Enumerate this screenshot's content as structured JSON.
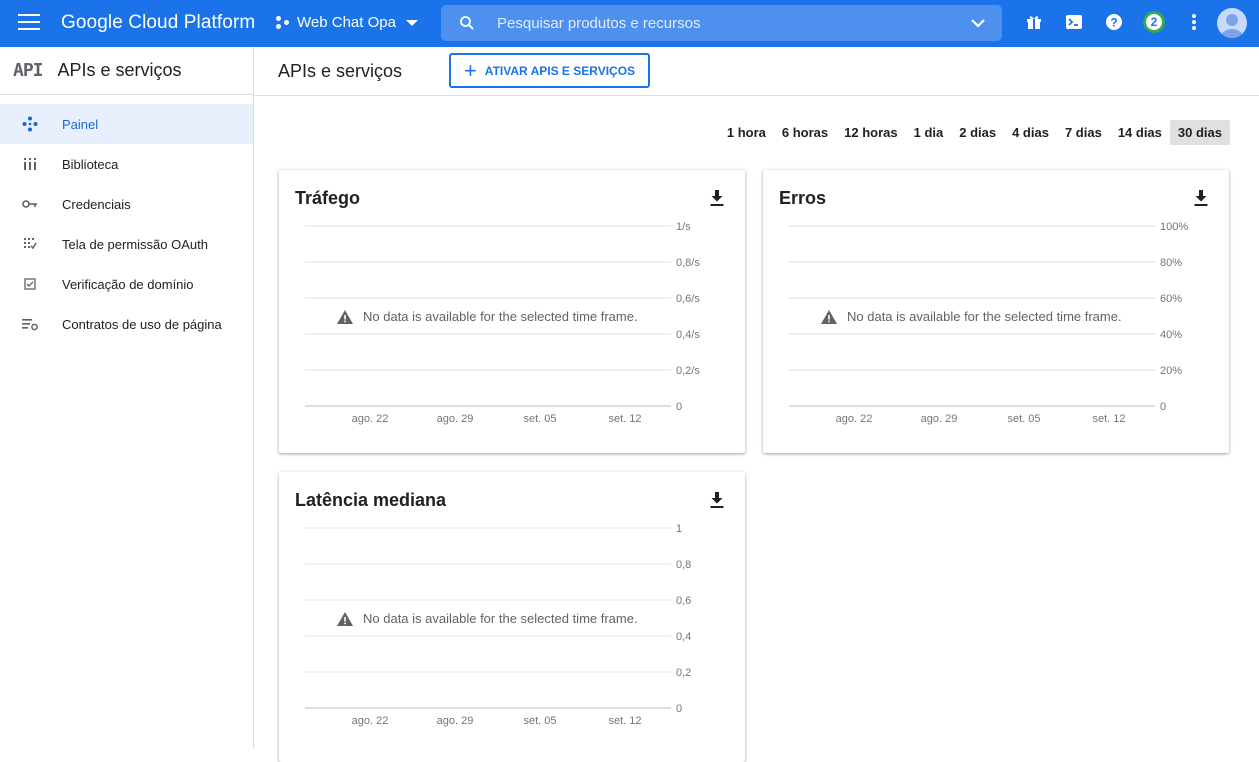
{
  "topbar": {
    "brand": "Google Cloud Platform",
    "project": "Web Chat Opa",
    "search_placeholder": "Pesquisar produtos e recursos",
    "notification_count": "2",
    "icons": [
      "gift-icon",
      "cloud-shell-icon",
      "help-icon",
      "notifications-badge",
      "more-vert-icon",
      "account-avatar"
    ]
  },
  "sidebar": {
    "logo": "API",
    "title": "APIs e serviços",
    "items": [
      {
        "label": "Painel",
        "icon": "dashboard-icon",
        "active": true
      },
      {
        "label": "Biblioteca",
        "icon": "library-icon"
      },
      {
        "label": "Credenciais",
        "icon": "key-icon"
      },
      {
        "label": "Tela de permissão OAuth",
        "icon": "oauth-consent-icon"
      },
      {
        "label": "Verificação de domínio",
        "icon": "domain-check-icon"
      },
      {
        "label": "Contratos de uso de página",
        "icon": "page-usage-icon"
      }
    ]
  },
  "main": {
    "title": "APIs e serviços",
    "enable_button": "ATIVAR APIS E SERVIÇOS",
    "time_ranges": [
      "1 hora",
      "6 horas",
      "12 horas",
      "1 dia",
      "2 dias",
      "4 dias",
      "7 dias",
      "14 dias",
      "30 dias"
    ],
    "selected_range": "30 dias",
    "no_data_message": "No data is available for the selected time frame."
  },
  "colors": {
    "accent": "#1a73e8",
    "active_bg": "#e8f0fe",
    "badge_ring": "#34a853"
  },
  "chart_data": [
    {
      "type": "line",
      "title": "Tráfego",
      "x": [
        "ago. 22",
        "ago. 29",
        "set. 05",
        "set. 12"
      ],
      "yticks": [
        "1/s",
        "0,8/s",
        "0,6/s",
        "0,4/s",
        "0,2/s",
        "0"
      ],
      "ylim": [
        0,
        1
      ],
      "series": [],
      "grid": true
    },
    {
      "type": "line",
      "title": "Erros",
      "x": [
        "ago. 22",
        "ago. 29",
        "set. 05",
        "set. 12"
      ],
      "yticks": [
        "100%",
        "80%",
        "60%",
        "40%",
        "20%",
        "0"
      ],
      "ylim": [
        0,
        100
      ],
      "series": [],
      "grid": true
    },
    {
      "type": "line",
      "title": "Latência mediana",
      "x": [
        "ago. 22",
        "ago. 29",
        "set. 05",
        "set. 12"
      ],
      "yticks": [
        "1",
        "0,8",
        "0,6",
        "0,4",
        "0,2",
        "0"
      ],
      "ylim": [
        0,
        1
      ],
      "series": [],
      "grid": true
    }
  ]
}
